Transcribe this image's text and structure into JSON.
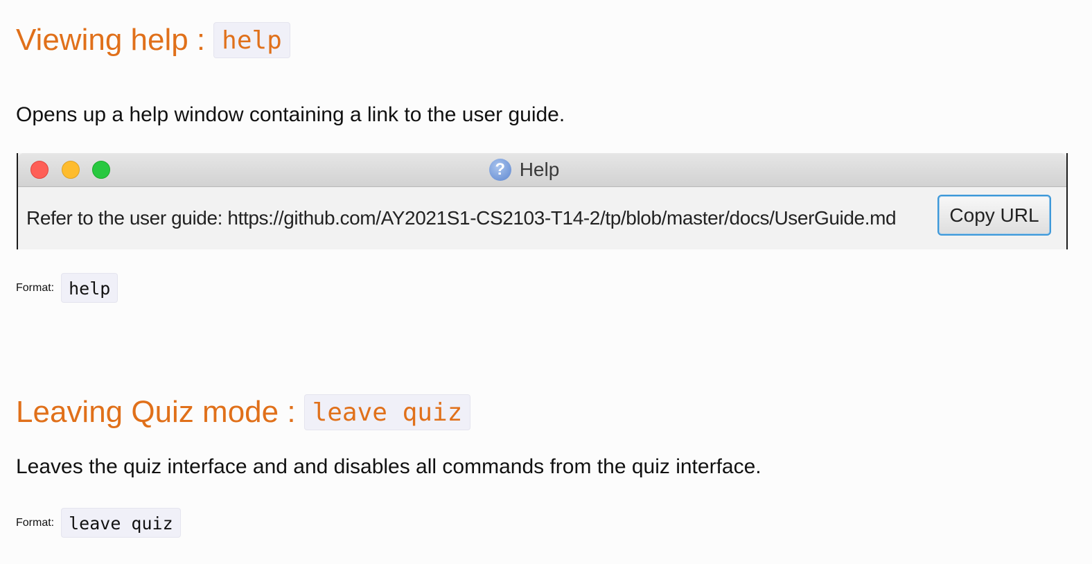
{
  "sections": [
    {
      "title": "Viewing help :",
      "command": "help",
      "description": "Opens up a help window containing a link to the user guide.",
      "format_label": "Format:",
      "format_code": "help"
    },
    {
      "title": "Leaving Quiz mode :",
      "command": "leave quiz",
      "description": "Leaves the quiz interface and and disables all commands from the quiz interface.",
      "format_label": "Format:",
      "format_code": "leave quiz"
    }
  ],
  "help_window": {
    "title": "Help",
    "title_icon": "question-icon",
    "message": "Refer to the user guide: https://github.com/AY2021S1-CS2103-T14-2/tp/blob/master/docs/UserGuide.md",
    "copy_button_label": "Copy URL"
  },
  "colors": {
    "heading": "#e0701a",
    "code_background": "#f0f0f8",
    "button_focus": "#3d98d9",
    "traffic_close": "#fe5f57",
    "traffic_minimize": "#febc2e",
    "traffic_maximize": "#28c840"
  }
}
